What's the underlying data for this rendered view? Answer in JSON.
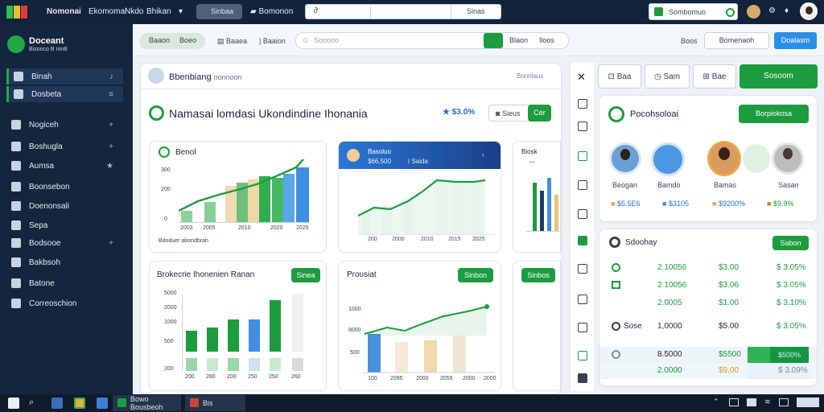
{
  "topbar": {
    "app_name": "Nomonai",
    "menu_1": "Ekomomai",
    "menu_2": "Nkdo",
    "menu_3": "Bhikan",
    "pill_label": "Sinbaa",
    "tab_label": "Bomonon",
    "search_label": "Sinas",
    "account_label": "Sombomuo"
  },
  "sidebar": {
    "brand": "Doceant",
    "brand_sub": "Bisonco B mnB",
    "items": [
      {
        "label": "Binah"
      },
      {
        "label": "Dosbeta"
      },
      {
        "label": "Nogiceh"
      },
      {
        "label": "Boshugla"
      },
      {
        "label": "Aumsa"
      },
      {
        "label": "Boonsebon"
      },
      {
        "label": "Doenonsali"
      },
      {
        "label": "Sepa"
      },
      {
        "label": "Bodsooe"
      },
      {
        "label": "Bakbsoh"
      },
      {
        "label": "Batone"
      },
      {
        "label": "Correoschion"
      }
    ]
  },
  "toolbar": {
    "pill_1": "Baaon",
    "pill_2": "Boeo",
    "tab_1": "Baaea",
    "tab_2": "Baaion",
    "search_placeholder": "Sooooo",
    "search_btn_1": "Blaon",
    "search_btn_2": "Iloos",
    "right_label": "Boos",
    "right_btn_1": "Bomenaoh",
    "right_btn_2": "Doalasm"
  },
  "panel": {
    "header": "Bbenbiang",
    "header_sub": "nonnoon",
    "header_right": "Bonnlaus",
    "title": "Namasai lomdasi Ukondindine Ihonania",
    "stat": "$3.0%",
    "btn_outline": "Sieus",
    "btn_green": "Cer"
  },
  "cards": {
    "c1_title": "Benol",
    "c1_y_ticks": [
      "300",
      "200",
      "0"
    ],
    "c1_x_labels": [
      "2003",
      "2005",
      "2010",
      "2020",
      "2025"
    ],
    "c1_x_caption": "Bdoduer abondbrah",
    "c2_title": "Basoluo",
    "c2_sub_1": "$66,500",
    "c2_sub_2": "Saida",
    "c2_x_labels": [
      "200",
      "2000",
      "2010",
      "2015",
      "2025"
    ],
    "c3_title": "Biosk",
    "c4_title": "Brokecrie Ihonenien Ranan",
    "c4_btn": "Sinea",
    "c4_y_ticks": [
      "5000",
      "2000",
      "1000",
      "500",
      "200"
    ],
    "c4_x_labels": [
      "200",
      "280",
      "200",
      "250",
      "250",
      "260"
    ],
    "c5_title": "Prousiat",
    "c5_btn": "Sinbon",
    "c5_y_ticks": [
      "1000",
      "8000",
      "500"
    ],
    "c5_x_labels": [
      "100",
      "2095",
      "2000",
      "2055",
      "2000",
      "2000"
    ],
    "c6_btn": "Sinbos"
  },
  "chart_data": [
    {
      "type": "bar",
      "title": "Benol",
      "categories": [
        "2003",
        "2005",
        "2010",
        "2020",
        "2025"
      ],
      "values": [
        40,
        90,
        170,
        200,
        210
      ],
      "ylim": [
        0,
        300
      ]
    },
    {
      "type": "area",
      "title": "Basoluo",
      "x": [
        "200",
        "2000",
        "2010",
        "2015",
        "2025"
      ],
      "values": [
        40,
        70,
        90,
        180,
        190
      ]
    },
    {
      "type": "bar",
      "title": "Brokecrie Ihonenien Ranan",
      "categories": [
        "200",
        "280",
        "200",
        "250",
        "250",
        "260"
      ],
      "values": [
        600,
        650,
        950,
        950,
        1400,
        1500
      ]
    },
    {
      "type": "line",
      "title": "Prousiat",
      "x": [
        "100",
        "2095",
        "2000",
        "2055",
        "2000",
        "2000"
      ],
      "values": [
        300,
        380,
        480,
        600,
        720,
        920
      ]
    }
  ],
  "right": {
    "tabs": [
      "Baa",
      "Sam",
      "Bae"
    ],
    "tab_green": "Sosoom",
    "profile_title": "Pocohsoloai",
    "profile_btn": "Borpiokosa",
    "people": [
      {
        "label": "Beogan",
        "value": "$5.5E6"
      },
      {
        "label": "Bamdo",
        "value": "$3105"
      },
      {
        "label": "Bamas",
        "value": "$9200%"
      },
      {
        "label": "Sasan",
        "value": "$9.9%"
      }
    ],
    "table_title": "Sdoohay",
    "table_btn": "Sabon",
    "rows": [
      {
        "c1": "",
        "c2": "2.10056",
        "c3": "$3.00",
        "c4": "$ 3.05%"
      },
      {
        "c1": "",
        "c2": "2.10056",
        "c3": "$3.06",
        "c4": "$ 3.05%"
      },
      {
        "c1": "",
        "c2": "2.0005",
        "c3": "$1.00",
        "c4": "$ 3.10%"
      },
      {
        "c1": "Sose",
        "c2": "1,0000",
        "c3": "$5.00",
        "c4": "$ 3.05%"
      },
      {
        "c1": "",
        "c2": "8.5000",
        "c3": "$5500",
        "c4": "$500%"
      },
      {
        "c1": "",
        "c2": "2.0000",
        "c3": "$9,00",
        "c4": "$ 3.09%"
      }
    ]
  },
  "taskbar": {
    "tab_1": "Bowo Bousbeoh",
    "tab_2": "Bis"
  },
  "colors": {
    "accent": "#1d9c3f",
    "navy": "#14263f",
    "blue": "#3f8ee3",
    "sand": "#f0cf92"
  }
}
